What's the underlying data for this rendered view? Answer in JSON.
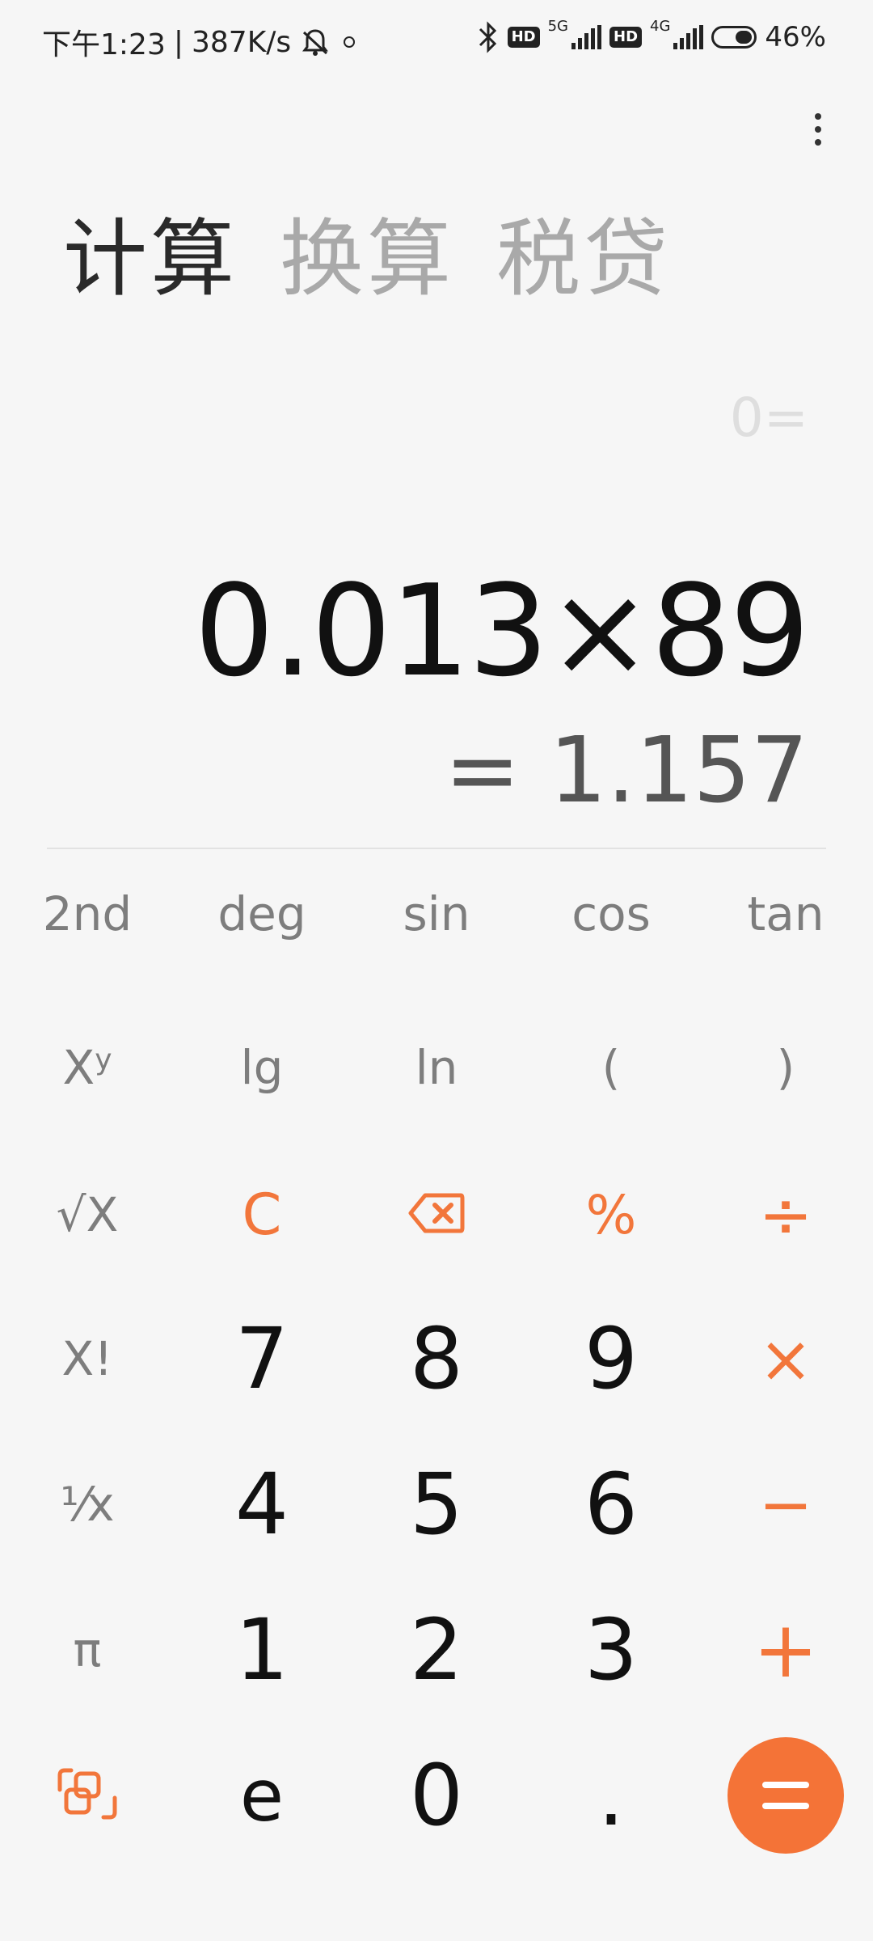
{
  "status_bar": {
    "time": "下午1:23",
    "separator": "|",
    "net_speed": "387K/s",
    "bluetooth_icon": "bluetooth-icon",
    "hd1": "HD",
    "net1": "5G",
    "hd2": "HD",
    "net2": "4G",
    "battery_percent": "46%",
    "battery_level": 0.46
  },
  "tabs": [
    {
      "label": "计算",
      "active": true
    },
    {
      "label": "换算",
      "active": false
    },
    {
      "label": "税贷",
      "active": false
    }
  ],
  "display": {
    "history": "0=",
    "expression": "0.013×89",
    "result": "= 1.157"
  },
  "keys": {
    "second": "2nd",
    "deg": "deg",
    "sin": "sin",
    "cos": "cos",
    "tan": "tan",
    "power_base": "X",
    "power_exp": "y",
    "lg": "lg",
    "ln": "ln",
    "lparen": "(",
    "rparen": ")",
    "sqrt": "√X",
    "clear": "C",
    "percent": "%",
    "divide": "÷",
    "factorial": "X!",
    "seven": "7",
    "eight": "8",
    "nine": "9",
    "multiply": "×",
    "reciprocal": "¹⁄x",
    "four": "4",
    "five": "5",
    "six": "6",
    "minus": "−",
    "pi": "π",
    "one": "1",
    "two": "2",
    "three": "3",
    "plus": "+",
    "e": "e",
    "zero": "0",
    "dot": "."
  },
  "colors": {
    "accent": "#f47337",
    "text_primary": "#111111",
    "text_secondary": "#7d7d7d"
  }
}
